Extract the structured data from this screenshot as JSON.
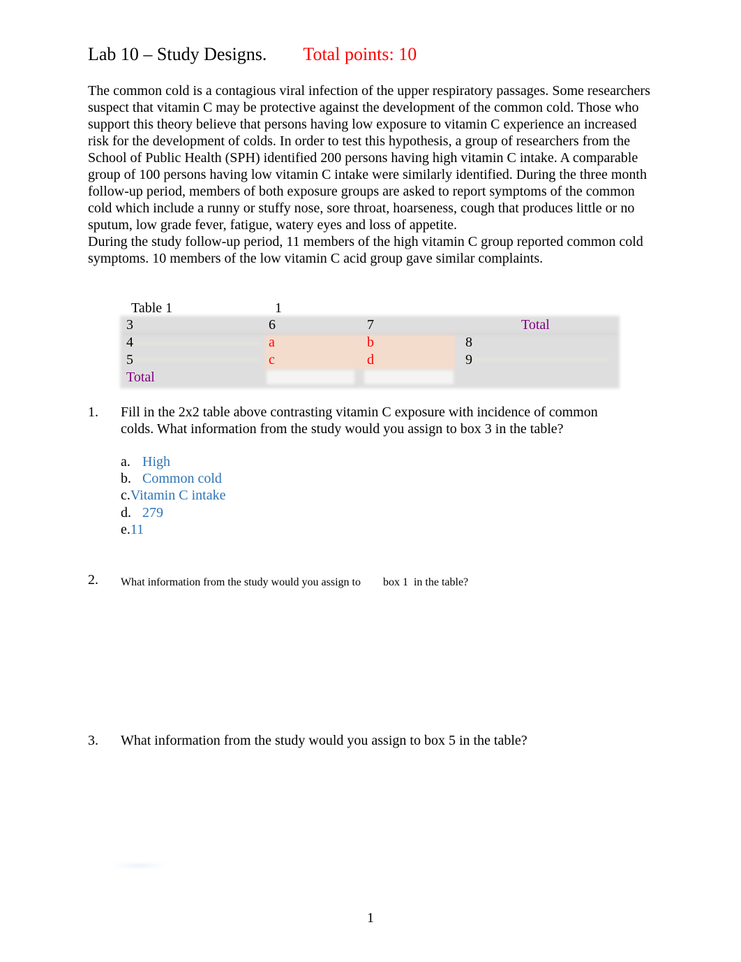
{
  "header": {
    "title": "Lab 10 – Study Designs.",
    "points": "Total points: 10"
  },
  "intro": {
    "paragraph1": "The common cold is a contagious viral infection of the upper respiratory passages. Some researchers suspect that vitamin C may be protective against the development of the common cold. Those who support this theory believe that persons having low exposure to vitamin C experience an increased risk for the development of colds. In order to test this hypothesis, a group of researchers from the School of Public Health (SPH) identified 200 persons having high vitamin C intake. A comparable group of 100 persons having low vitamin C intake were similarly identified. During the three month follow-up period, members of both exposure groups are asked to report symptoms of the common cold which include a runny or stuffy nose, sore throat, hoarseness, cough that produces little or no sputum, low grade fever, fatigue, watery eyes and loss of appetite.",
    "paragraph2": "During the study follow-up period, 11 members of the high vitamin C group reported common cold symptoms. 10 members of the low vitamin C acid group gave similar complaints."
  },
  "table": {
    "caption": "Table 1",
    "box1": "1",
    "rows": [
      [
        "3",
        "6",
        "7",
        "Total"
      ],
      [
        "4",
        "a",
        "b",
        "8"
      ],
      [
        "5",
        "c",
        "d",
        "9"
      ],
      [
        "Total",
        "",
        "",
        ""
      ]
    ]
  },
  "questions": [
    {
      "number": "1.",
      "text": "Fill in the 2x2 table above contrasting vitamin C exposure with incidence of common colds. What information from the study would you assign to box 3 in the table?",
      "options": [
        {
          "label": "a.",
          "text": "High"
        },
        {
          "label": "b.",
          "text": "Common cold"
        },
        {
          "label": "c.",
          "text": "Vitamin C intake"
        },
        {
          "label": "d.",
          "text": "279"
        },
        {
          "label": "e.",
          "text": "11"
        }
      ]
    },
    {
      "number": "2.",
      "text_part1": "What information from the study would you assign to",
      "text_part2": "box 1",
      "text_part3": "in the table?"
    },
    {
      "number": "3.",
      "text": "What information from the study would you assign to box 5 in the table?"
    }
  ],
  "footer": {
    "page_number": "1"
  },
  "colors": {
    "points": "#ff0000",
    "cell_letters": "#ff0000",
    "total_labels": "#800080",
    "answer_text": "#2e74b5",
    "table_gray": "#dedede",
    "table_peach": "#f4dccd"
  }
}
